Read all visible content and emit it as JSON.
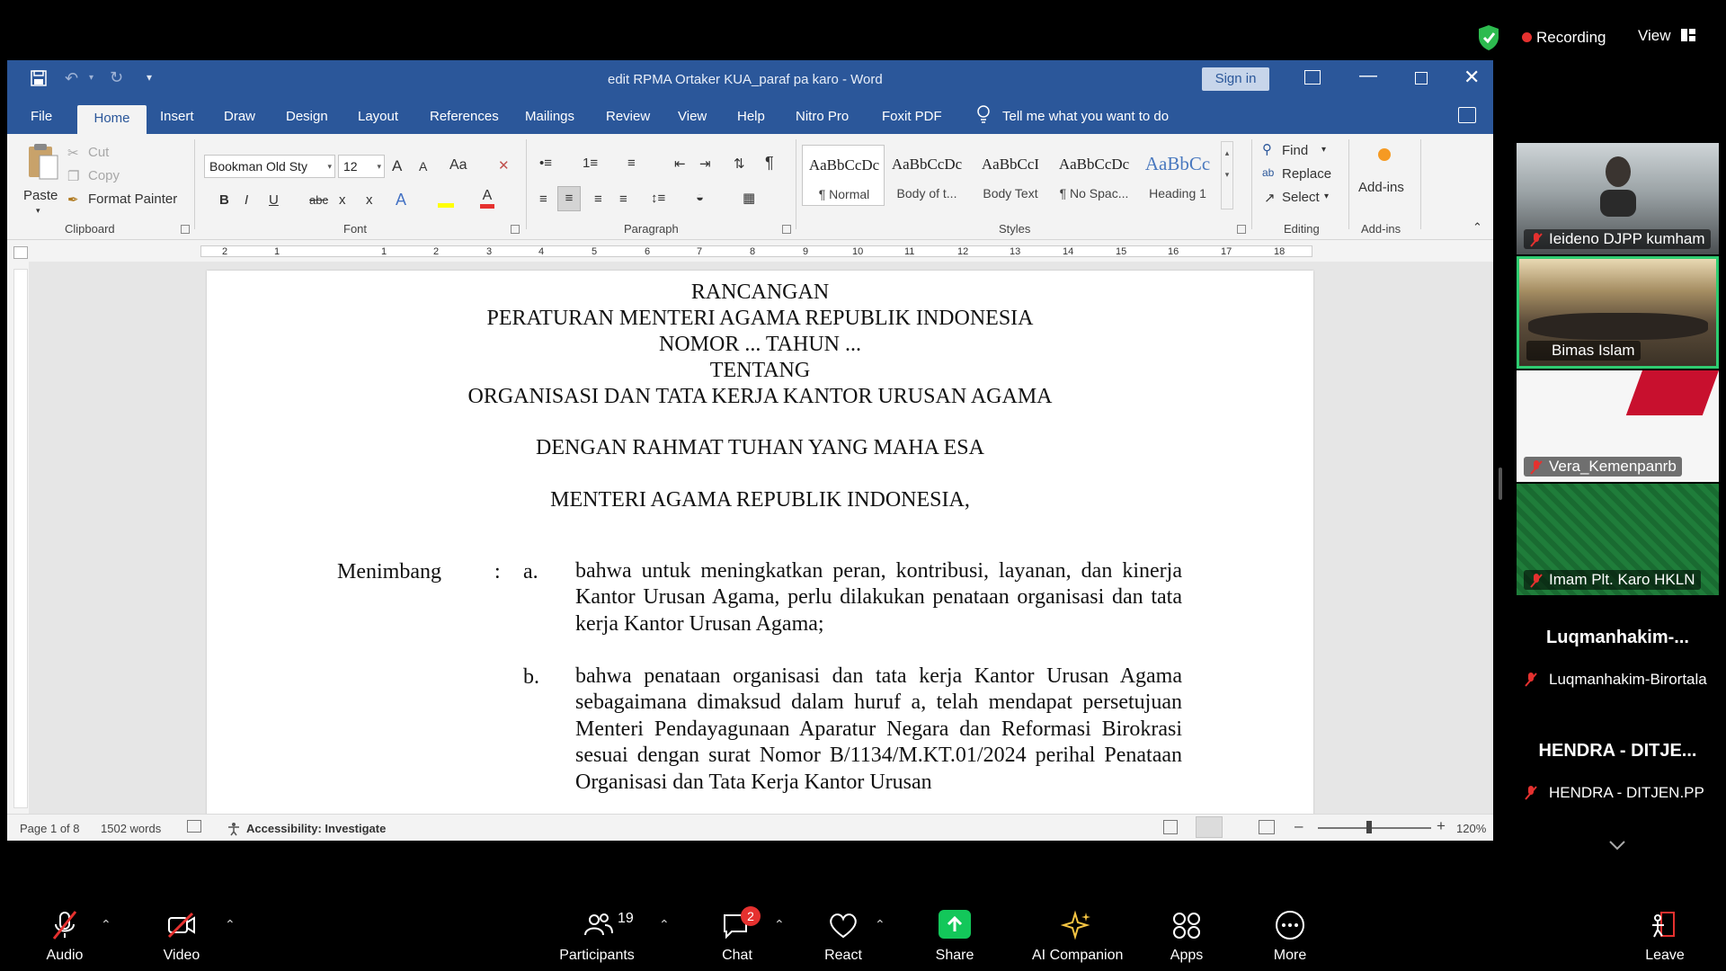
{
  "zoom_top": {
    "recording_label": "Recording",
    "view_label": "View"
  },
  "word": {
    "title": "edit RPMA Ortaker KUA_paraf pa karo  -  Word",
    "sign_in_label": "Sign in",
    "tabs": [
      "File",
      "Home",
      "Insert",
      "Draw",
      "Design",
      "Layout",
      "References",
      "Mailings",
      "Review",
      "View",
      "Help",
      "Nitro Pro",
      "Foxit PDF"
    ],
    "tell_me": "Tell me what you want to do",
    "ribbon": {
      "clipboard": {
        "paste": "Paste",
        "cut": "Cut",
        "copy": "Copy",
        "format_painter": "Format Painter",
        "label": "Clipboard"
      },
      "font": {
        "name": "Bookman Old Sty",
        "size": "12",
        "grow": "A",
        "shrink": "A",
        "case": "Aa",
        "bold": "B",
        "italic": "I",
        "underline": "U",
        "strike": "abc",
        "sub": "x",
        "sup": "x",
        "label": "Font"
      },
      "paragraph": {
        "label": "Paragraph"
      },
      "styles": {
        "items": [
          {
            "sample": "AaBbCcDc",
            "name": "¶ Normal"
          },
          {
            "sample": "AaBbCcDc",
            "name": "Body of t..."
          },
          {
            "sample": "AaBbCcI",
            "name": "Body Text"
          },
          {
            "sample": "AaBbCcDc",
            "name": "¶ No Spac..."
          },
          {
            "sample": "AaBbCc",
            "name": "Heading 1"
          }
        ],
        "label": "Styles"
      },
      "editing": {
        "find": "Find",
        "replace": "Replace",
        "select": "Select",
        "label": "Editing"
      },
      "addins": {
        "button": "Add-ins",
        "label": "Add-ins"
      }
    },
    "ruler_numbers": [
      "2",
      "1",
      "1",
      "2",
      "3",
      "4",
      "5",
      "6",
      "7",
      "8",
      "9",
      "10",
      "11",
      "12",
      "13",
      "14",
      "15",
      "16",
      "17",
      "18"
    ],
    "document": {
      "lines": [
        "RANCANGAN",
        "PERATURAN MENTERI AGAMA REPUBLIK INDONESIA",
        "NOMOR ... TAHUN ...",
        "TENTANG",
        "ORGANISASI DAN TATA KERJA KANTOR URUSAN AGAMA",
        "DENGAN RAHMAT TUHAN YANG MAHA ESA",
        "MENTERI AGAMA REPUBLIK INDONESIA,"
      ],
      "menimbang": "Menimbang",
      "colon": ":",
      "items": [
        {
          "letter": "a.",
          "text": "bahwa untuk meningkatkan peran, kontribusi, layanan, dan kinerja Kantor Urusan Agama, perlu dilakukan penataan organisasi dan tata kerja Kantor Urusan Agama;"
        },
        {
          "letter": "b.",
          "text": "bahwa penataan organisasi dan tata kerja Kantor Urusan Agama sebagaimana dimaksud dalam huruf a, telah mendapat persetujuan Menteri Pendayagunaan Aparatur Negara dan Reformasi Birokrasi sesuai dengan surat Nomor B/1134/M.KT.01/2024 perihal Penataan Organisasi dan Tata Kerja Kantor Urusan"
        }
      ]
    },
    "status": {
      "page": "Page 1 of 8",
      "words": "1502 words",
      "accessibility": "Accessibility: Investigate",
      "zoom": "120%"
    }
  },
  "participants": [
    {
      "name": "Ieideno DJPP kumham",
      "type": "video"
    },
    {
      "name": "Bimas Islam",
      "type": "video"
    },
    {
      "name": "Vera_Kemenpanrb",
      "type": "video"
    },
    {
      "name": "Imam Plt. Karo HKLN",
      "type": "video"
    },
    {
      "display": "Luqmanhakim-...",
      "name": "Luqmanhakim-Birortala",
      "type": "name"
    },
    {
      "display": "HENDRA - DITJE...",
      "name": "HENDRA - DITJEN.PP",
      "type": "name"
    }
  ],
  "toolbar": {
    "audio": "Audio",
    "video": "Video",
    "participants": "Participants",
    "participants_count": "19",
    "chat": "Chat",
    "chat_badge": "2",
    "react": "React",
    "share": "Share",
    "ai": "AI Companion",
    "apps": "Apps",
    "more": "More",
    "leave": "Leave"
  },
  "colors": {
    "word_blue": "#2b579a",
    "recording_red": "#e5312f",
    "share_green": "#13c75a",
    "active_tile": "#2ecc71"
  }
}
